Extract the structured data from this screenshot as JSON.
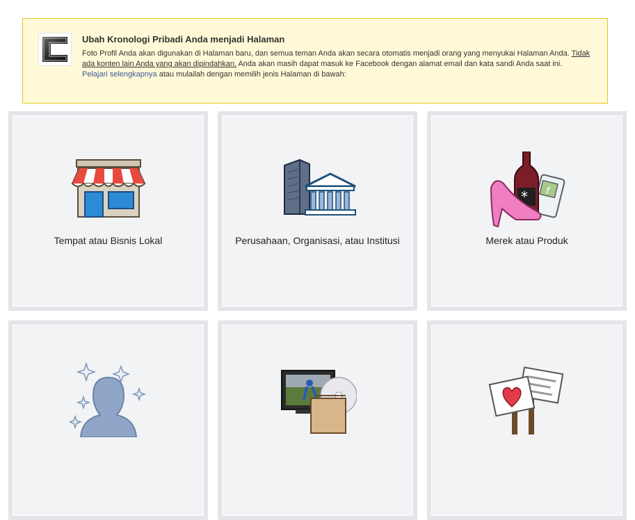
{
  "notice": {
    "title": "Ubah Kronologi Pribadi Anda menjadi Halaman",
    "text_1": "Foto Profil Anda akan digunakan di Halaman baru, dan semua teman Anda akan secara otomatis menjadi orang yang menyukai Halaman Anda. ",
    "text_underlined": "Tidak ada konten lain Anda yang akan dipindahkan.",
    "text_2": " Anda akan masih dapat masuk ke Facebook dengan alamat email dan kata sandi Anda saat ini.",
    "learn_more_link": "Pelajari selengkapnya",
    "text_3": " atau mulailah dengan memilih jenis Halaman di bawah:"
  },
  "categories": [
    {
      "label": "Tempat atau Bisnis Lokal",
      "icon": "storefront-icon"
    },
    {
      "label": "Perusahaan, Organisasi, atau Institusi",
      "icon": "buildings-icon"
    },
    {
      "label": "Merek atau Produk",
      "icon": "products-icon"
    },
    {
      "label": "",
      "icon": "public-figure-icon"
    },
    {
      "label": "",
      "icon": "entertainment-icon"
    },
    {
      "label": "",
      "icon": "cause-signs-icon"
    }
  ],
  "colors": {
    "notice_bg": "#fff9d7",
    "notice_border": "#e2c822",
    "link": "#3b5998",
    "tile_bg": "#f2f3f5",
    "tile_border": "#e3e5e9"
  }
}
